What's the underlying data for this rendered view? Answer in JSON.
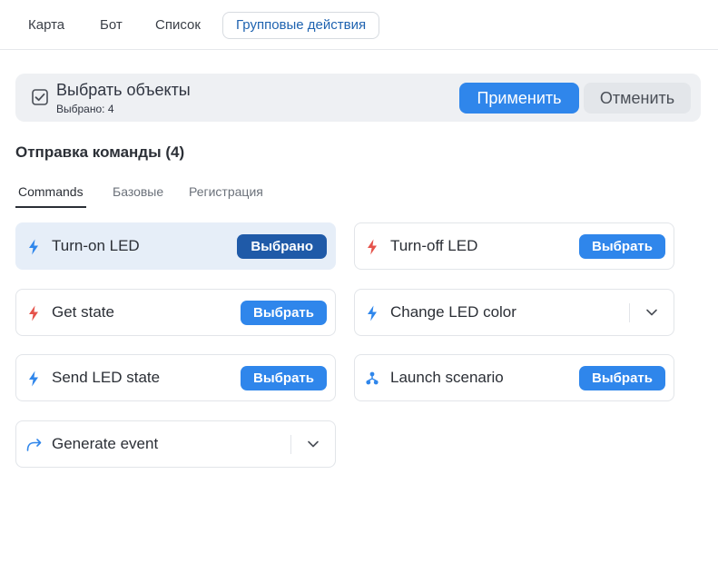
{
  "nav": {
    "tabs": [
      {
        "label": "Карта"
      },
      {
        "label": "Бот"
      },
      {
        "label": "Список"
      },
      {
        "label": "Групповые действия"
      }
    ],
    "active_tab": "Групповые действия"
  },
  "selection_bar": {
    "title": "Выбрать объекты",
    "count_text": "Выбрано: 4",
    "apply_label": "Применить",
    "cancel_label": "Отменить"
  },
  "section": {
    "title": "Отправка команды (4)"
  },
  "subtabs": [
    {
      "label": "Commands"
    },
    {
      "label": "Базовые"
    },
    {
      "label": "Регистрация"
    }
  ],
  "commands": [
    {
      "label": "Turn-on LED",
      "icon": "bolt-icon",
      "icon_color": "#2f86eb",
      "action": "Выбрано",
      "selected": true
    },
    {
      "label": "Turn-off LED",
      "icon": "bolt-icon",
      "icon_color": "#e5534b",
      "action": "Выбрать",
      "selected": false
    },
    {
      "label": "Get state",
      "icon": "bolt-icon",
      "icon_color": "#e5534b",
      "action": "Выбрать",
      "selected": false
    },
    {
      "label": "Change LED color",
      "icon": "bolt-icon",
      "icon_color": "#2f86eb",
      "action": "dropdown",
      "selected": false
    },
    {
      "label": "Send LED state",
      "icon": "bolt-icon",
      "icon_color": "#2f86eb",
      "action": "Выбрать",
      "selected": false
    },
    {
      "label": "Launch scenario",
      "icon": "scenario-icon",
      "icon_color": "#2f86eb",
      "action": "Выбрать",
      "selected": false
    },
    {
      "label": "Generate event",
      "icon": "event-arrow-icon",
      "icon_color": "#2f86eb",
      "action": "dropdown",
      "selected": false
    }
  ],
  "colors": {
    "accent": "#2f86eb",
    "accent_dark": "#1f5aa8",
    "bolt_red": "#e5534b",
    "selected_card_bg": "#e6eef8"
  }
}
